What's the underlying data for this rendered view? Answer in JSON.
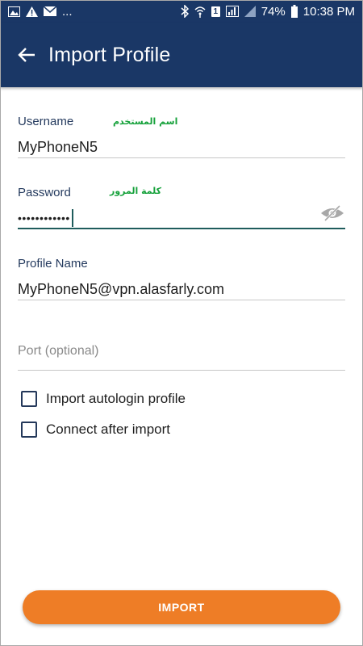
{
  "status_bar": {
    "notification_icons": [
      "image-icon",
      "warning-icon",
      "mail-icon"
    ],
    "more": "...",
    "battery": "74%",
    "time": "10:38 PM",
    "sim_badge": "1"
  },
  "app_bar": {
    "title": "Import Profile"
  },
  "form": {
    "username": {
      "label": "Username",
      "hint": "اسم المستخدم",
      "value": "MyPhoneN5"
    },
    "password": {
      "label": "Password",
      "hint": "كلمة المرور",
      "value": "••••••••••••"
    },
    "profile_name": {
      "label": "Profile Name",
      "value": "MyPhoneN5@vpn.alasfarly.com"
    },
    "port": {
      "placeholder": "Port (optional)"
    }
  },
  "options": [
    {
      "label": "Import autologin profile",
      "checked": false
    },
    {
      "label": "Connect after import",
      "checked": false
    }
  ],
  "actions": {
    "import_label": "IMPORT"
  },
  "colors": {
    "primary": "#1a3766",
    "accent": "#ee7d26",
    "hint_text": "#15a13a"
  }
}
